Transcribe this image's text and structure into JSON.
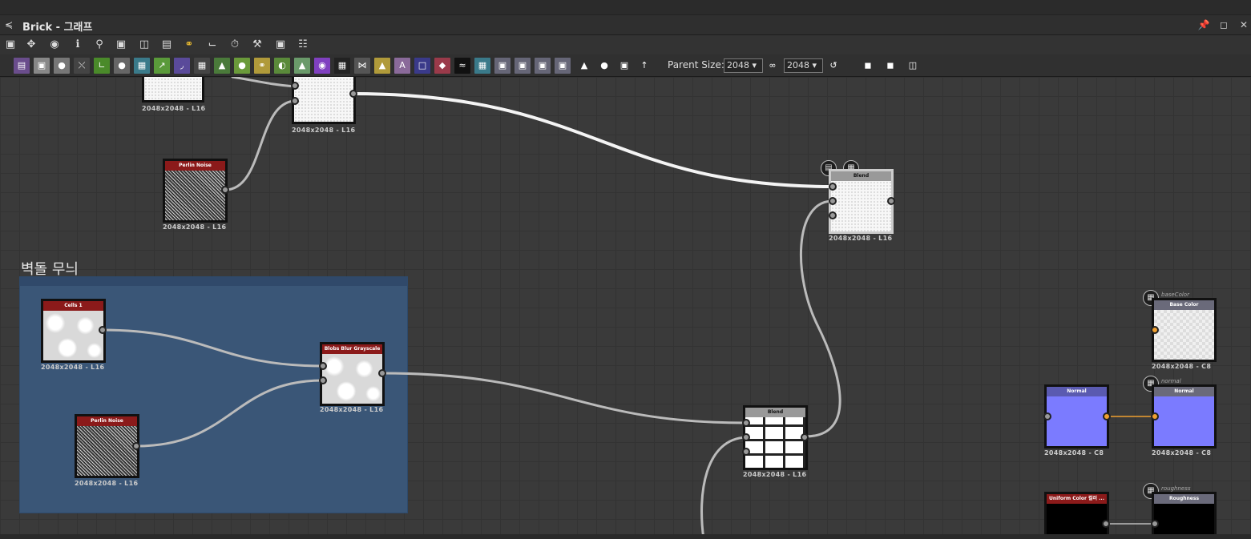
{
  "window": {
    "title": "Brick - 그래프"
  },
  "toolbar2": {
    "parent_size_label": "Parent Size:",
    "size_a": "2048",
    "size_b": "2048"
  },
  "frame": {
    "title": "벽돌 무늬"
  },
  "nodes": {
    "top_left": {
      "res": "2048x2048 - L16"
    },
    "top_mid": {
      "res": "2048x2048 - L16"
    },
    "perlin1": {
      "title": "Perlin Noise",
      "res": "2048x2048 - L16"
    },
    "blend_top": {
      "title": "Blend",
      "res": "2048x2048 - L16"
    },
    "cells": {
      "title": "Cells 1",
      "res": "2048x2048 - L16"
    },
    "blur": {
      "title": "Blobs Blur Grayscale",
      "res": "2048x2048 - L16"
    },
    "perlin2": {
      "title": "Perlin Noise",
      "res": "2048x2048 - L16"
    },
    "blend_bot": {
      "title": "Blend",
      "res": "2048x2048 - L16"
    },
    "basecolor": {
      "tag": "baseColor",
      "title": "Base Color",
      "res": "2048x2048 - C8"
    },
    "normal_in": {
      "title": "Normal",
      "res": "2048x2048 - C8"
    },
    "normal_out": {
      "tag": "normal",
      "title": "Normal",
      "res": "2048x2048 - C8"
    },
    "uniform": {
      "title": "Uniform Color 컬러 ..."
    },
    "roughness": {
      "tag": "roughness",
      "title": "Roughness"
    }
  },
  "icons": {
    "graph": "graph-icon",
    "pin": "pin-icon",
    "maximize": "maximize-icon",
    "close": "close-icon",
    "output": "output-icon"
  }
}
